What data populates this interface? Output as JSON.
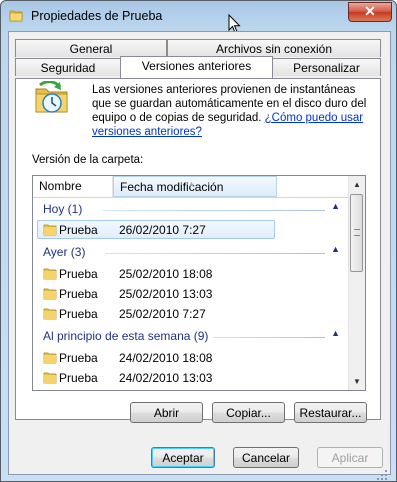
{
  "window": {
    "title": "Propiedades de Prueba",
    "close_label": "✕"
  },
  "tabs_row1": [
    {
      "label": "General"
    },
    {
      "label": "Archivos sin conexión"
    }
  ],
  "tabs_row2": [
    {
      "label": "Seguridad"
    },
    {
      "label": "Versiones anteriores",
      "active": true
    },
    {
      "label": "Personalizar"
    }
  ],
  "info": {
    "text": "Las versiones anteriores provienen de instantáneas que se guardan automáticamente en el disco duro del equipo o de copias de seguridad. ",
    "link": "¿Cómo puedo usar versiones anteriores?"
  },
  "folder_version_label": "Versión de la carpeta:",
  "list": {
    "columns": [
      "Nombre",
      "Fecha modificación"
    ],
    "groups": [
      {
        "label": "Hoy (1)",
        "rows": [
          {
            "name": "Prueba",
            "date": "26/02/2010 7:27",
            "selected": true
          }
        ]
      },
      {
        "label": "Ayer (3)",
        "rows": [
          {
            "name": "Prueba",
            "date": "25/02/2010 18:08"
          },
          {
            "name": "Prueba",
            "date": "25/02/2010 13:03"
          },
          {
            "name": "Prueba",
            "date": "25/02/2010 7:27"
          }
        ]
      },
      {
        "label": "Al principio de esta semana (9)",
        "rows": [
          {
            "name": "Prueba",
            "date": "24/02/2010 18:08"
          },
          {
            "name": "Prueba",
            "date": "24/02/2010 13:03"
          }
        ]
      }
    ]
  },
  "panel_buttons": {
    "open": "Abrir",
    "copy": "Copiar...",
    "restore": "Restaurar..."
  },
  "dialog_buttons": {
    "ok": "Aceptar",
    "cancel": "Cancelar",
    "apply": "Aplicar"
  },
  "colors": {
    "link": "#0033cc",
    "group_header": "#1e3287",
    "selection": "#a5c9ef"
  }
}
